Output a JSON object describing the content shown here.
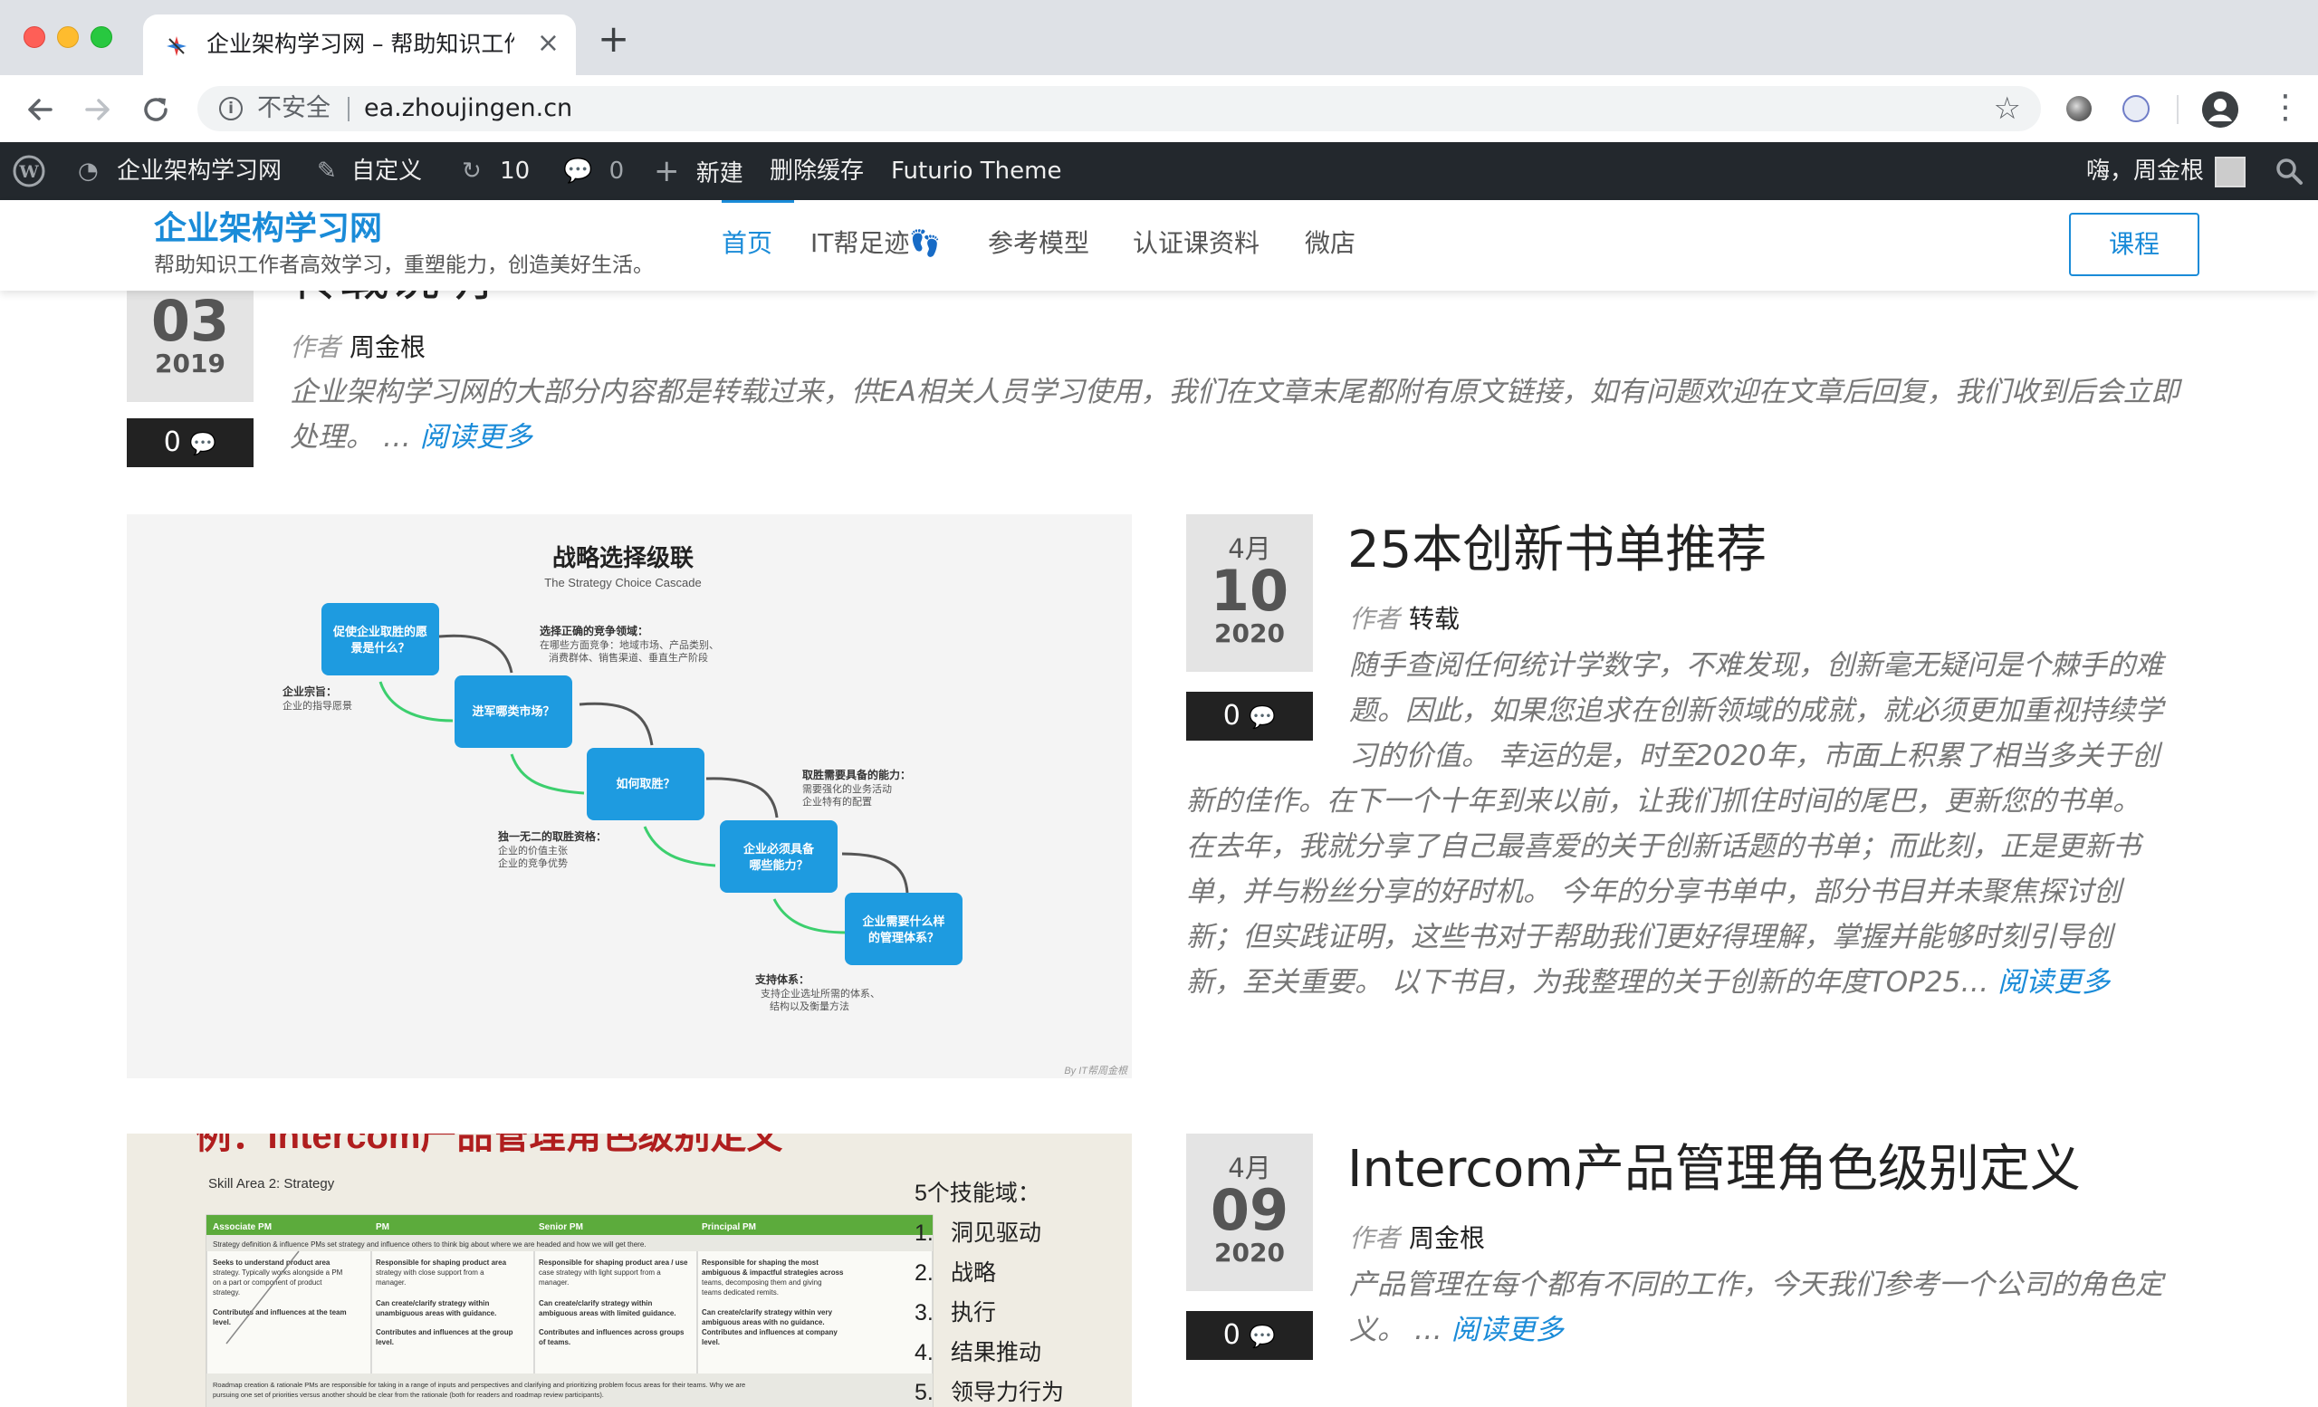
{
  "browser": {
    "tab_title": "企业架构学习网 – 帮助知识工作者",
    "tab_close": "×",
    "new_tab": "+",
    "insecure_label": "不安全",
    "url": "ea.zhoujingen.cn"
  },
  "adminbar": {
    "site_name": "企业架构学习网",
    "customize": "自定义",
    "updates": "10",
    "comments": "0",
    "new": "新建",
    "clear_cache": "删除缓存",
    "theme": "Futurio Theme",
    "greeting": "嗨，周金根"
  },
  "site": {
    "title": "企业架构学习网",
    "tagline": "帮助知识工作者高效学习，重塑能力，创造美好生活。",
    "menu": [
      "首页",
      "IT帮足迹👣",
      "参考模型",
      "认证课资料",
      "微店"
    ],
    "cta": "课程"
  },
  "posts": [
    {
      "title": "转载说明",
      "day": "03",
      "year": "2019",
      "comments": "0",
      "author_label": "作者",
      "author": "周金根",
      "excerpt": "企业架构学习网的大部分内容都是转载过来，供EA相关人员学习使用，我们在文章末尾都附有原文链接，如有问题欢迎在文章后回复，我们收到后会立即处理。 …",
      "read_more": "阅读更多"
    },
    {
      "title": "25本创新书单推荐",
      "month": "4月",
      "day": "10",
      "year": "2020",
      "comments": "0",
      "author_label": "作者",
      "author": "转载",
      "excerpt_lines": [
        "随手查阅任何统计学数字，不难发现，创新毫无疑问是个棘手的难",
        "题。因此，如果您追求在创新领域的成就，就必须更加重视持续学",
        "习的价值。 幸运的是，时至2020年，市面上积累了相当多关于创",
        "新的佳作。在下一个十年到来以前，让我们抓住时间的尾巴，更新您的书单。",
        "在去年，我就分享了自己最喜爱的关于创新话题的书单；而此刻，正是更新书",
        "单，并与粉丝分享的好时机。 今年的分享书单中，部分书目并未聚焦探讨创",
        "新；但实践证明，这些书对于帮助我们更好得理解，掌握并能够时刻引导创",
        "新，至关重要。 以下书目，为我整理的关于创新的年度TOP25…"
      ],
      "read_more": "阅读更多",
      "image": {
        "title": "战略选择级联",
        "subtitle": "The Strategy Choice Cascade",
        "boxes": [
          "促使企业取胜的愿景是什么？",
          "进军哪类市场？",
          "如何取胜？",
          "企业必须具备哪些能力？",
          "企业需要什么样的管理体系？"
        ],
        "note1_title": "企业宗旨：",
        "note1_items": [
          "企业的指导愿景"
        ],
        "note2_title": "选择正确的竞争领域：",
        "note2_items": [
          "在哪些方面竞争：地域市场、产品类别、消费群体、销售渠道、垂直生产阶段"
        ],
        "note3_title": "取胜需要具备的能力：",
        "note3_items": [
          "需要强化的业务活动",
          "企业特有的配置"
        ],
        "note4_title": "独一无二的取胜资格：",
        "note4_items": [
          "企业的价值主张",
          "企业的竞争优势"
        ],
        "note5_title": "支持体系：",
        "note5_items": [
          "支持企业选址所需的体系、",
          "结构以及衡量方法"
        ],
        "credit": "By IT帮周金根"
      }
    },
    {
      "title": "Intercom产品管理角色级别定义",
      "month": "4月",
      "day": "09",
      "year": "2020",
      "comments": "0",
      "author_label": "作者",
      "author": "周金根",
      "excerpt_lines": [
        "产品管理在每个都有不同的工作，今天我们参考一个公司的角色定",
        "义。 …"
      ],
      "read_more": "阅读更多",
      "image": {
        "banner": "例：Intercom产品管理角色级别定义",
        "skill_area": "Skill Area 2: Strategy",
        "columns": [
          "Associate PM",
          "PM",
          "Senior PM",
          "Principal PM"
        ],
        "row1": "Strategy definition & influence PMs set strategy and influence others to think big about where we are headed and how we will get there.",
        "cells": [
          "Seeks to understand product area strategy. Typically works alongside a PM on a part or component of product strategy.",
          "Responsible for shaping product area strategy with close support from a manager.",
          "Responsible for shaping product area / use case strategy with light support from a manager.",
          "Responsible for shaping the most ambiguous & impactful strategies across teams, decomposing them and giving teams dedicated remits."
        ],
        "cells2": [
          "Contributes and influences at the team level.",
          "Can create/clarify strategy within unambiguous areas with guidance.",
          "Can create/clarify strategy within ambiguous areas with limited guidance.",
          "Can create/clarify strategy within very ambiguous areas with no guidance."
        ],
        "cells3": [
          "",
          "Contributes and influences at the group level.",
          "Contributes and influences across groups of teams.",
          "Contributes and influences at company level."
        ],
        "row2": "Roadmap creation & rationale PMs are responsible for taking in a range of inputs and perspectives and clarifying and prioritizing problem focus areas for their teams. Why we are pursuing one set of priorities versus another should be clear from the rationale (both for readers and roadmap review participants).",
        "list_title": "5个技能域：",
        "list": [
          "洞见驱动",
          "战略",
          "执行",
          "结果推动",
          "领导力行为"
        ]
      }
    }
  ],
  "colors": {
    "accent": "#1a8bd8",
    "admin_bar": "#23282d",
    "comment_box": "#222222",
    "date_box": "#e4e4e4"
  }
}
